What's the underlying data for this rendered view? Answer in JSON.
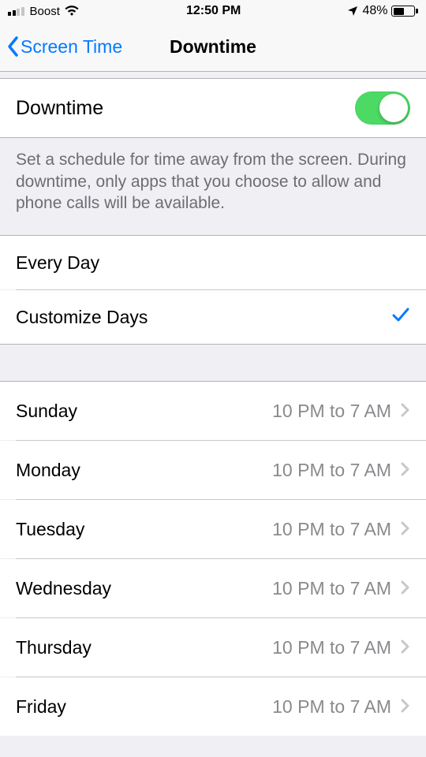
{
  "status": {
    "carrier": "Boost",
    "time": "12:50 PM",
    "battery_pct": "48%"
  },
  "nav": {
    "back_label": "Screen Time",
    "title": "Downtime"
  },
  "toggle": {
    "label": "Downtime",
    "on": true
  },
  "description": "Set a schedule for time away from the screen. During downtime, only apps that you choose to allow and phone calls will be available.",
  "modes": {
    "every_day": "Every Day",
    "customize_days": "Customize Days",
    "selected": "customize_days"
  },
  "days": [
    {
      "name": "Sunday",
      "range": "10 PM to 7 AM"
    },
    {
      "name": "Monday",
      "range": "10 PM to 7 AM"
    },
    {
      "name": "Tuesday",
      "range": "10 PM to 7 AM"
    },
    {
      "name": "Wednesday",
      "range": "10 PM to 7 AM"
    },
    {
      "name": "Thursday",
      "range": "10 PM to 7 AM"
    },
    {
      "name": "Friday",
      "range": "10 PM to 7 AM"
    }
  ]
}
